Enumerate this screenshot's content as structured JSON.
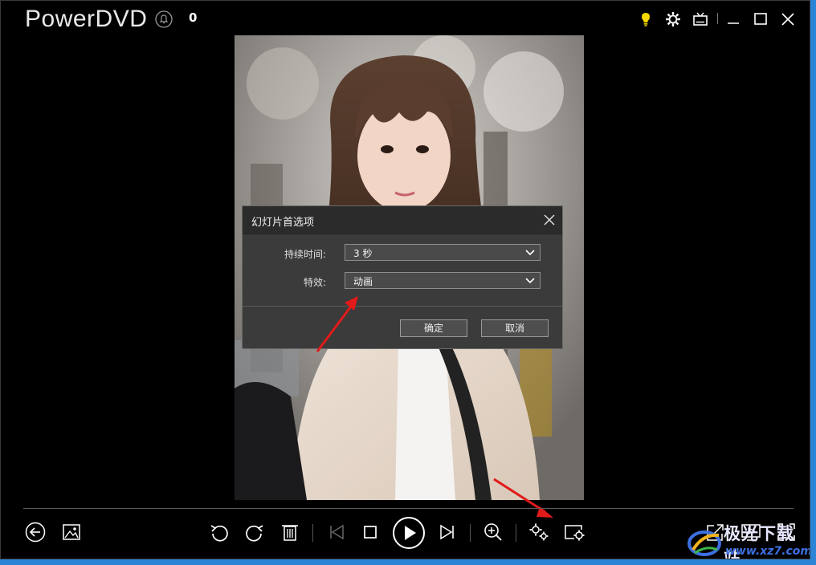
{
  "app": {
    "title": "PowerDVD",
    "notification_count": "0"
  },
  "titlebar_icons": [
    "bulb-icon",
    "gear-icon",
    "tv-icon",
    "minimize-icon",
    "maximize-icon",
    "close-icon"
  ],
  "colors": {
    "bulb": "#f5d800",
    "arrow": "#e11a1a",
    "dialog_bg": "#3b3b3b",
    "dialog_header": "#2b2b2b"
  },
  "dialog": {
    "title": "幻灯片首选项",
    "duration_label": "持续时间:",
    "duration_value": "3 秒",
    "effect_label": "特效:",
    "effect_value": "动画",
    "ok_label": "确定",
    "cancel_label": "取消"
  },
  "toolbar_icons": [
    "back-icon",
    "gallery-icon",
    "rotate-left-icon",
    "rotate-right-icon",
    "delete-icon",
    "previous-icon",
    "stop-icon",
    "play-icon",
    "next-icon",
    "zoom-icon",
    "settings-icon",
    "slideshow-settings-icon",
    "share-icon",
    "cast-icon",
    "fullscreen-icon"
  ],
  "watermark": {
    "text": "极光下载站",
    "url": "www.xz7.com"
  }
}
